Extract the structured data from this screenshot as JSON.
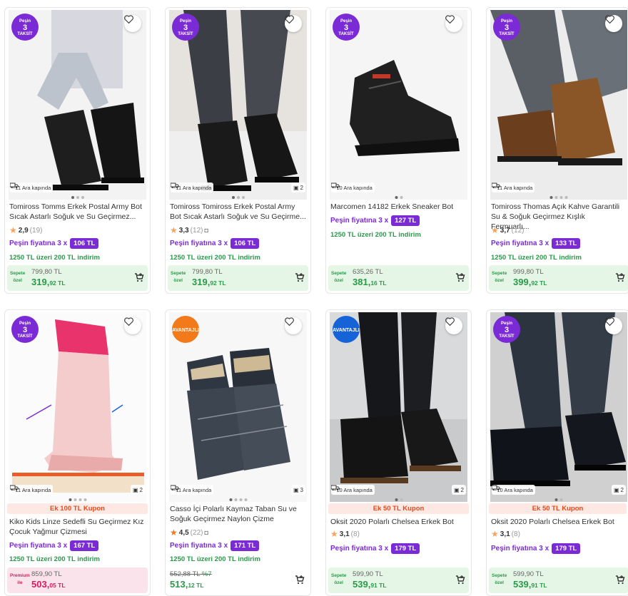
{
  "products": [
    {
      "badge": "pesin",
      "badge_line1": "Peşin",
      "badge_line2": "3",
      "badge_line3": "fiyatına taksit",
      "delivery": "~11 Ara kapında",
      "photo_count": "",
      "coupon": "",
      "title": "Tomiross Tomms Erkek Postal Army Bot Sıcak Astarlı Soğuk ve Su Geçirmez...",
      "rating": "2,9",
      "rating_count": "(19)",
      "installment_text": "Peşin fiyatına 3 x",
      "installment_price": "106 TL",
      "promo": "1250 TL üzeri 200 TL indirim",
      "sepet_label1": "Sepete",
      "sepet_label2": "özel",
      "old_price": "799,80 TL",
      "new_price_main": "319,",
      "new_price_cents": "92 TL"
    },
    {
      "badge": "pesin",
      "badge_line1": "Peşin",
      "badge_line2": "3",
      "badge_line3": "fiyatına taksit",
      "delivery": "~11 Ara kapında",
      "photo_count": "2",
      "coupon": "",
      "title": "Tomiross Tomiross Erkek Postal Army Bot Sıcak Astarlı Soğuk ve Su Geçirme...",
      "rating": "3,3",
      "rating_count": "(12)",
      "installment_text": "Peşin fiyatına 3 x",
      "installment_price": "106 TL",
      "promo": "1250 TL üzeri 200 TL indirim",
      "sepet_label1": "Sepete",
      "sepet_label2": "özel",
      "old_price": "799,80 TL",
      "new_price_main": "319,",
      "new_price_cents": "92 TL"
    },
    {
      "badge": "pesin",
      "badge_line1": "Peşin",
      "badge_line2": "3",
      "badge_line3": "fiyatına taksit",
      "delivery": "~10 Ara kapında",
      "photo_count": "",
      "coupon": "",
      "title": "Marcomen 14182 Erkek Sneaker Bot",
      "rating": "",
      "rating_count": "",
      "installment_text": "Peşin fiyatına 3 x",
      "installment_price": "127 TL",
      "promo": "1250 TL üzeri 200 TL indirim",
      "sepet_label1": "Sepete",
      "sepet_label2": "özel",
      "old_price": "635,26 TL",
      "new_price_main": "381,",
      "new_price_cents": "16 TL"
    },
    {
      "badge": "pesin",
      "badge_line1": "Peşin",
      "badge_line2": "3",
      "badge_line3": "fiyatına taksit",
      "delivery": "~11 Ara kapında",
      "photo_count": "",
      "coupon": "",
      "title": "Tomiross Thomas Açık Kahve Garantili Su & Soğuk Geçirmez Kışlık Fermuarlı...",
      "rating": "3,7",
      "rating_count": "(12)",
      "installment_text": "Peşin fiyatına 3 x",
      "installment_price": "133 TL",
      "promo": "1250 TL üzeri 200 TL indirim",
      "sepet_label1": "Sepete",
      "sepet_label2": "özel",
      "old_price": "999,80 TL",
      "new_price_main": "399,",
      "new_price_cents": "92 TL"
    },
    {
      "badge": "pesin",
      "badge_line1": "Peşin",
      "badge_line2": "3",
      "badge_line3": "fiyatına taksit",
      "delivery": "~11 Ara kapında",
      "photo_count": "2",
      "coupon": "Ek 100 TL Kupon",
      "title": "Kiko Kids Linze Sedefli Su Geçirmez Kız Çocuk Yağmur Çizmesi",
      "rating": "",
      "rating_count": "",
      "installment_text": "Peşin fiyatına 3 x",
      "installment_price": "167 TL",
      "promo": "1250 TL üzeri 200 TL indirim",
      "sepet_label1": "Premium",
      "sepet_label2": "ile",
      "old_price": "859,90 TL",
      "new_price_main": "503,",
      "new_price_cents": "05 TL"
    },
    {
      "badge": "avantaj",
      "badge_line1": "",
      "badge_line2": "AVANTAJLI",
      "badge_line3": "",
      "delivery": "~11 Ara kapında",
      "photo_count": "3",
      "coupon": "",
      "title": "Casso İçi Polarlı Kaymaz Taban Su ve Soğuk Geçirmez Naylon Çizme",
      "rating": "4,5",
      "rating_count": "(22)",
      "installment_text": "Peşin fiyatına 3 x",
      "installment_price": "171 TL",
      "promo": "1250 TL üzeri 200 TL indirim",
      "sepet_label1": "",
      "sepet_label2": "",
      "old_price": "552,88 TL",
      "discount_pct": "%7",
      "new_price_main": "513,",
      "new_price_cents": "12 TL"
    },
    {
      "badge": "avantaj",
      "badge_line1": "",
      "badge_line2": "AVANTAJLI",
      "badge_line3": "",
      "delivery": "~10 Ara kapında",
      "photo_count": "2",
      "coupon": "Ek 50 TL Kupon",
      "title": "Oksit 2020 Polarlı Chelsea Erkek Bot",
      "rating": "3,1",
      "rating_count": "(8)",
      "installment_text": "Peşin fiyatına 3 x",
      "installment_price": "179 TL",
      "promo": "",
      "sepet_label1": "Sepete",
      "sepet_label2": "özel",
      "old_price": "599,90 TL",
      "new_price_main": "539,",
      "new_price_cents": "91 TL"
    },
    {
      "badge": "pesin",
      "badge_line1": "Peşin",
      "badge_line2": "3",
      "badge_line3": "fiyatına taksit",
      "delivery": "~10 Ara kapında",
      "photo_count": "2",
      "coupon": "Ek 50 TL Kupon",
      "title": "Oksit 2020 Polarlı Chelsea Erkek Bot",
      "rating": "3,1",
      "rating_count": "(8)",
      "installment_text": "Peşin fiyatına 3 x",
      "installment_price": "179 TL",
      "promo": "",
      "sepet_label1": "Sepete",
      "sepet_label2": "özel",
      "old_price": "599,90 TL",
      "new_price_main": "539,",
      "new_price_cents": "91 TL"
    }
  ],
  "colors": {
    "accent": "#7b2bd6",
    "green": "#2a9a4a",
    "orange": "#f27a1a",
    "pink": "#d81b60"
  },
  "icons": {
    "favorite": "heart-icon",
    "cart": "add-to-cart-icon",
    "truck": "truck-icon",
    "star": "star-icon",
    "camera": "camera-icon"
  }
}
